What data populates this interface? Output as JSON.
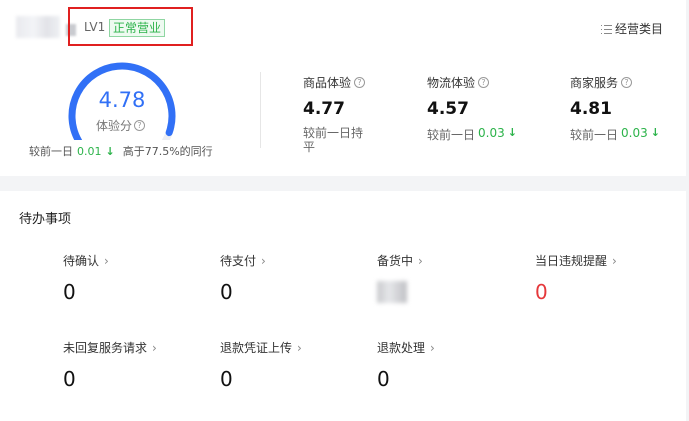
{
  "header": {
    "level": "LV1",
    "status": "正常营业",
    "category_button": "经营类目"
  },
  "score": {
    "value": "4.78",
    "fraction_of_max": 0.956,
    "label": "体验分",
    "compare_prefix": "较前一日",
    "compare_value": "0.01",
    "percentile_text": "高于77.5%的同行"
  },
  "metrics": [
    {
      "title": "商品体验",
      "value": "4.77",
      "compare_prefix": "较前一日",
      "compare_value": "持平",
      "trend": "flat"
    },
    {
      "title": "物流体验",
      "value": "4.57",
      "compare_prefix": "较前一日",
      "compare_value": "0.03",
      "trend": "down"
    },
    {
      "title": "商家服务",
      "value": "4.81",
      "compare_prefix": "较前一日",
      "compare_value": "0.03",
      "trend": "down"
    }
  ],
  "todos": {
    "title": "待办事项",
    "items": [
      {
        "label": "待确认",
        "count": "0"
      },
      {
        "label": "待支付",
        "count": "0"
      },
      {
        "label": "备货中",
        "count": ""
      },
      {
        "label": "当日违规提醒",
        "count": "0"
      },
      {
        "label": "未回复服务请求",
        "count": "0"
      },
      {
        "label": "退款凭证上传",
        "count": "0"
      },
      {
        "label": "退款处理",
        "count": "0"
      }
    ]
  },
  "colors": {
    "accent": "#3170f6",
    "positive_down": "#2cb34a",
    "alert": "#e5383b",
    "highlight_border": "#e02020"
  },
  "icons": {
    "category": "list-icon",
    "help": "question-circle-icon",
    "arrow": "arrow-down-icon",
    "chevron": "chevron-right-icon"
  }
}
